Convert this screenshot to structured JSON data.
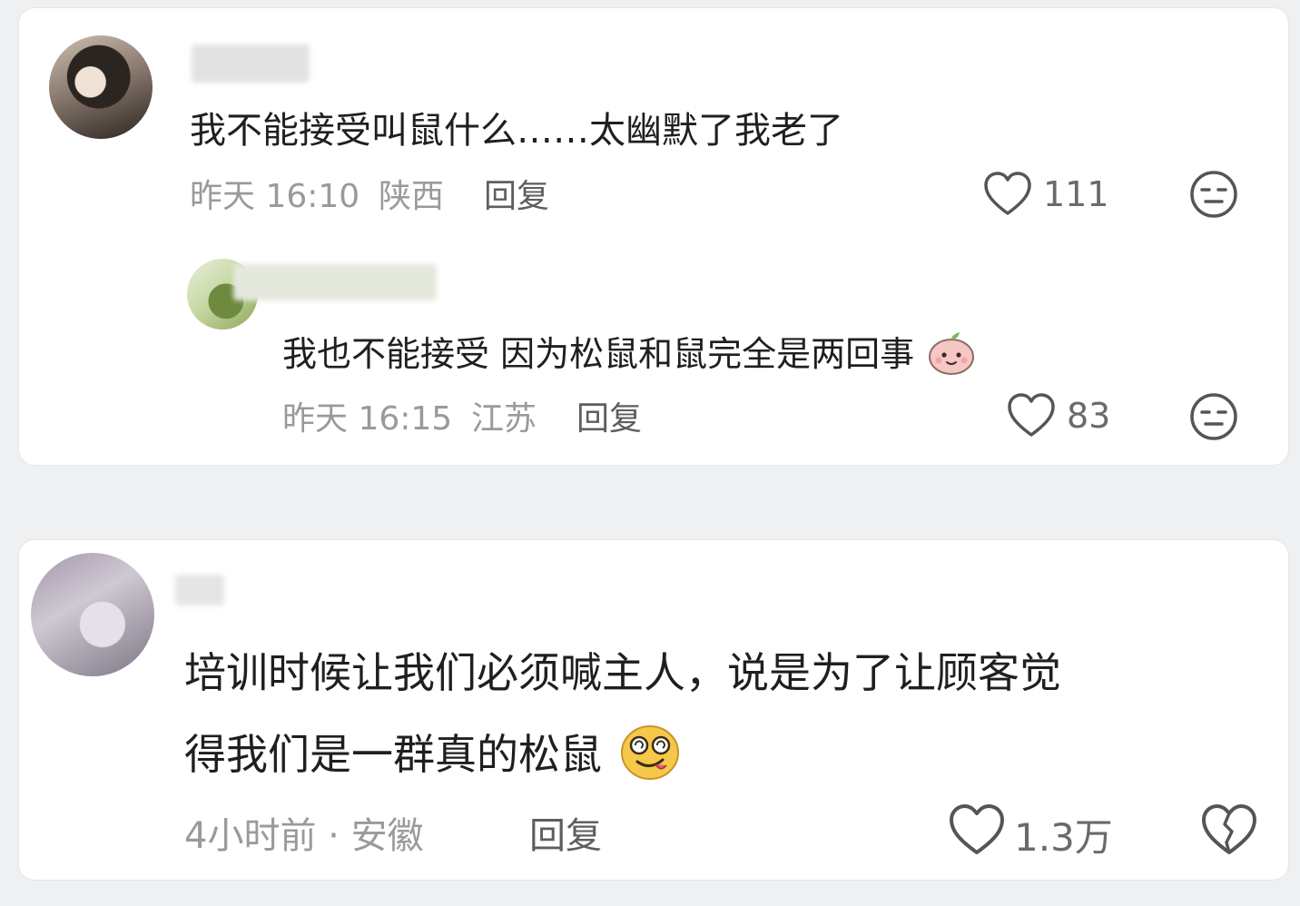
{
  "comments": [
    {
      "text": "我不能接受叫鼠什么……太幽默了我老了",
      "time": "昨天 16:10",
      "location": "陕西",
      "reply_label": "回复",
      "likes": "111",
      "replies": [
        {
          "text": "我也不能接受 因为松鼠和鼠完全是两回事",
          "time": "昨天 16:15",
          "location": "江苏",
          "reply_label": "回复",
          "likes": "83"
        }
      ]
    },
    {
      "text_line1": "培训时候让我们必须喊主人，说是为了让顾客觉",
      "text_line2": "得我们是一群真的松鼠",
      "meta": "4小时前 · 安徽",
      "reply_label": "回复",
      "likes": "1.3万"
    }
  ]
}
